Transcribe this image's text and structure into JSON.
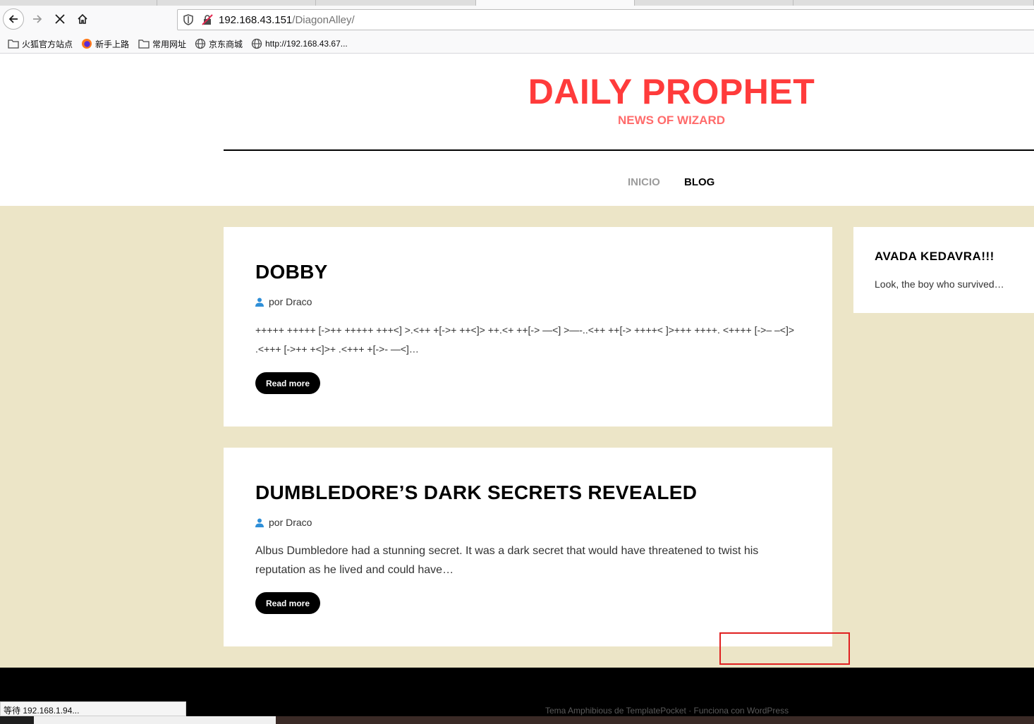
{
  "browser": {
    "url_host": "192.168.43.151",
    "url_path": "/DiagonAlley/",
    "bookmarks": [
      {
        "label": "火狐官方站点",
        "icon": "folder-icon"
      },
      {
        "label": "新手上路",
        "icon": "firefox-icon"
      },
      {
        "label": "常用网址",
        "icon": "folder-icon"
      },
      {
        "label": "京东商城",
        "icon": "globe-icon"
      },
      {
        "label": "http://192.168.43.67...",
        "icon": "globe-icon"
      }
    ],
    "status_text": "等待 192.168.1.94..."
  },
  "site": {
    "title": "DAILY PROPHET",
    "tagline": "NEWS OF WIZARD",
    "title_color": "#ff3b3b",
    "menu": [
      {
        "label": "INICIO",
        "active": false
      },
      {
        "label": "BLOG",
        "active": true
      }
    ]
  },
  "posts": [
    {
      "title": "DOBBY",
      "byline": "por Draco",
      "excerpt": "+++++ +++++ [->++ +++++ +++<] >.<++ +[->+ ++<]> ++.<+ ++[-> —<] >—-..<++ ++[-> ++++< ]>+++ ++++. <++++ [->– –<]> .<+++ [->++ +<]>+ .<+++ +[->- —<]…",
      "read_more": "Read more"
    },
    {
      "title": "DUMBLEDORE’S DARK SECRETS REVEALED",
      "byline": "por Draco",
      "excerpt": "Albus Dumbledore had a stunning secret. It was a dark secret that would have threatened to twist his reputation as he lived and could have…",
      "read_more": "Read more"
    }
  ],
  "sidebar": {
    "widget_title": "AVADA KEDAVRA!!!",
    "widget_text": "Look, the boy who survived…"
  },
  "footer": {
    "text": "Tema Amphibious de TemplatePocket · Funciona con WordPress"
  },
  "colors": {
    "content_background": "#ece5c7",
    "footer_background": "#000000",
    "highlight_box": "#e02020"
  }
}
